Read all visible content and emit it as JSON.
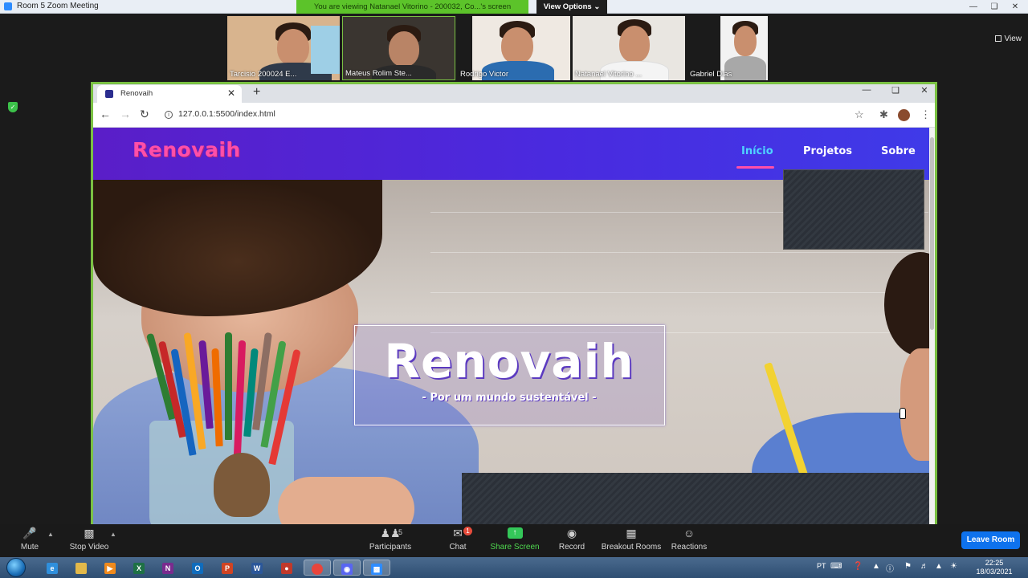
{
  "zoom": {
    "window_title": "Room 5   Zoom Meeting",
    "viewing_banner": "You are viewing Natanael Vitorino - 200032, Co...'s screen",
    "view_options_label": "View Options ⌄",
    "view_label": "View",
    "participants": [
      {
        "name": "Tarcisio 200024 E...",
        "bg": "#d8b48e",
        "shirt": "#2f3a4a"
      },
      {
        "name": "Mateus Rolim Ste...",
        "bg": "#3a3530",
        "shirt": "#2a2a2a"
      },
      {
        "name": "Rodrigo Victor",
        "bg": "#efe9e2",
        "shirt": "#2b6cb0"
      },
      {
        "name": "Natanael Vitorino ...",
        "bg": "#e9e6e1",
        "shirt": "#f4f4f4"
      },
      {
        "name": "Gabriel Dias",
        "bg": "#f2f2f2",
        "shirt": "#a8a8a8"
      }
    ],
    "toolbar": {
      "mute_label": "Mute",
      "video_label": "Stop Video",
      "participants_label": "Participants",
      "participants_count": "5",
      "chat_label": "Chat",
      "chat_badge": "1",
      "share_label": "Share Screen",
      "record_label": "Record",
      "breakout_label": "Breakout Rooms",
      "reactions_label": "Reactions",
      "leave_label": "Leave Room"
    }
  },
  "browser": {
    "tab_title": "Renovaih",
    "url": "127.0.0.1:5500/index.html"
  },
  "site": {
    "logo": "Renovaih",
    "nav": [
      {
        "label": "Início",
        "active": true
      },
      {
        "label": "Projetos",
        "active": false
      },
      {
        "label": "Sobre",
        "active": false
      }
    ],
    "hero_title": "Renovaih",
    "hero_subtitle": "- Por um mundo sustentável -"
  },
  "taskbar": {
    "language": "PT",
    "time": "22:25",
    "date": "18/03/2021"
  },
  "colors": {
    "zoom_green": "#5cc32a",
    "share_frame": "#7ac143",
    "site_nav_start": "#5a1ec8",
    "site_nav_end": "#3f3ae8",
    "logo_pink": "#ff4fa8",
    "nav_active": "#4fd3ff",
    "leave_blue": "#0e72ed"
  }
}
